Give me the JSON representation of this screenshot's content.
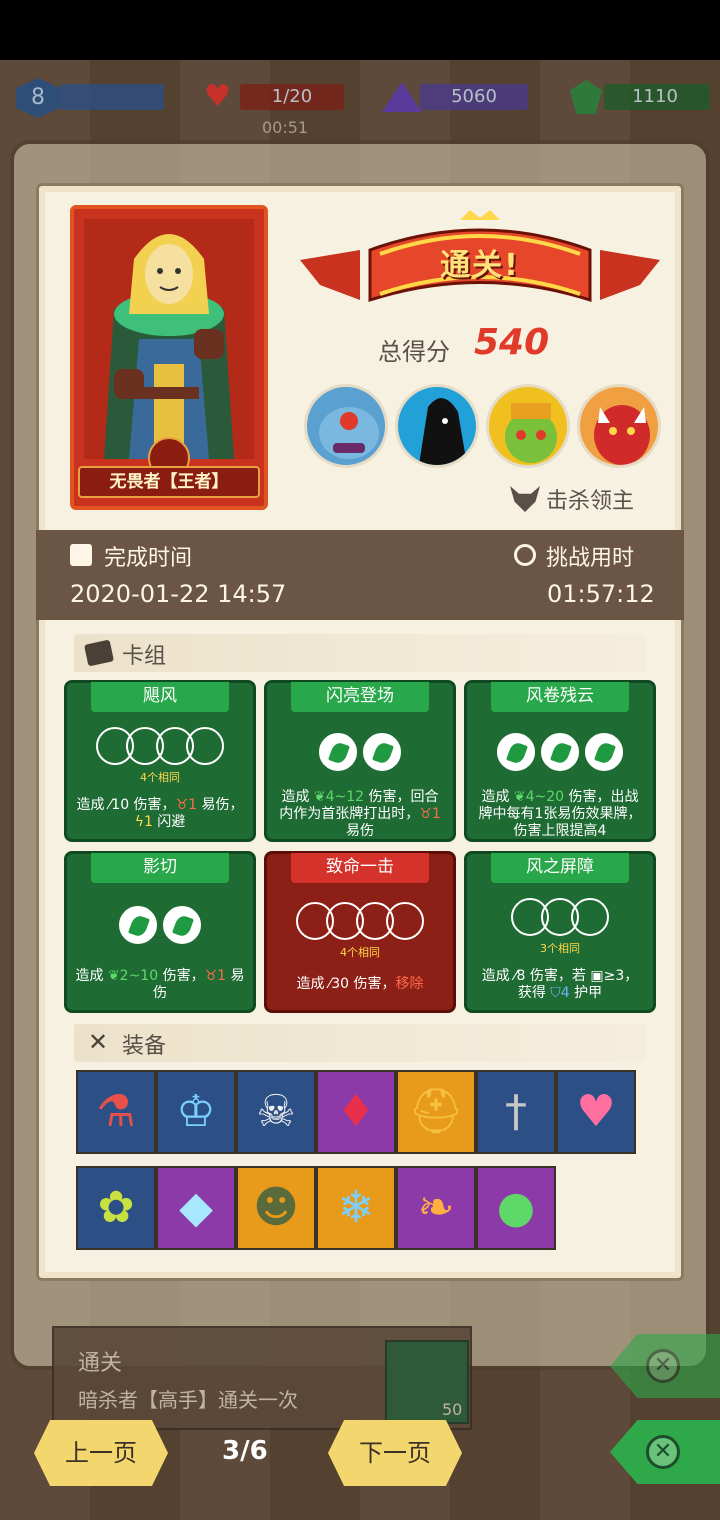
{
  "hud": {
    "level": "8",
    "hp": "1/20",
    "gems": "5060",
    "crystals": "1110",
    "timer": "00:51"
  },
  "hero": {
    "name": "无畏者【王者】"
  },
  "result": {
    "banner": "通关!",
    "score_label": "总得分",
    "score_value": "540",
    "kill_label": "击杀领主"
  },
  "times": {
    "complete_label": "完成时间",
    "complete_value": "2020-01-22 14:57",
    "challenge_label": "挑战用时",
    "challenge_value": "01:57:12"
  },
  "deck": {
    "header": "卡组",
    "cards": [
      {
        "title": "飓风",
        "same": "4个相同",
        "desc_a": "造成 ",
        "desc_b": "10 伤害，",
        "desc_c": "1",
        "desc_d": " 易伤，",
        "desc_e": "1",
        "desc_f": " 闪避"
      },
      {
        "title": "闪亮登场",
        "desc_a": "造成 ",
        "desc_b": "4~12",
        "desc_c": " 伤害，回合内作为首张牌打出时，",
        "desc_d": "1",
        "desc_e": " 易伤"
      },
      {
        "title": "风卷残云",
        "desc_a": "造成 ",
        "desc_b": "4~20",
        "desc_c": " 伤害，出战牌中每有1张易伤效果牌，伤害上限提高4"
      },
      {
        "title": "影切",
        "desc_a": "造成 ",
        "desc_b": "2~10",
        "desc_c": " 伤害，",
        "desc_d": "1",
        "desc_e": " 易伤"
      },
      {
        "title": "致命一击",
        "same": "4个相同",
        "desc_a": "造成 ",
        "desc_b": "30 伤害，",
        "desc_c": "移除"
      },
      {
        "title": "风之屏障",
        "same": "3个相同",
        "desc_a": "造成 ",
        "desc_b": "8 伤害，若 ",
        "desc_c": "≥3",
        "desc_d": "，获得 ",
        "desc_e": "4",
        "desc_f": " 护甲"
      }
    ]
  },
  "equipment": {
    "header": "装备",
    "items": [
      {
        "icon": "potion-jar-icon",
        "color": "#2c4f86"
      },
      {
        "icon": "ice-crown-icon",
        "color": "#2c4f86"
      },
      {
        "icon": "skull-icon",
        "color": "#2c4f86"
      },
      {
        "icon": "ruby-necklace-icon",
        "color": "#8c3aa8"
      },
      {
        "icon": "golden-helmet-icon",
        "color": "#e89a1a"
      },
      {
        "icon": "dagger-icon",
        "color": "#2c4f86"
      },
      {
        "icon": "heart-box-icon",
        "color": "#2c4f86"
      },
      {
        "icon": "leafy-cube-icon",
        "color": "#2c4f86"
      },
      {
        "icon": "diamond-icon",
        "color": "#8c3aa8"
      },
      {
        "icon": "mask-icon",
        "color": "#e89a1a"
      },
      {
        "icon": "frost-gem-icon",
        "color": "#e89a1a"
      },
      {
        "icon": "phoenix-feather-icon",
        "color": "#8c3aa8"
      },
      {
        "icon": "wind-orb-icon",
        "color": "#8c3aa8"
      }
    ]
  },
  "achievement": {
    "title": "通关",
    "desc": "暗杀者【高手】通关一次",
    "reward": "50"
  },
  "nav": {
    "prev": "上一页",
    "next": "下一页",
    "page": "3/6"
  }
}
